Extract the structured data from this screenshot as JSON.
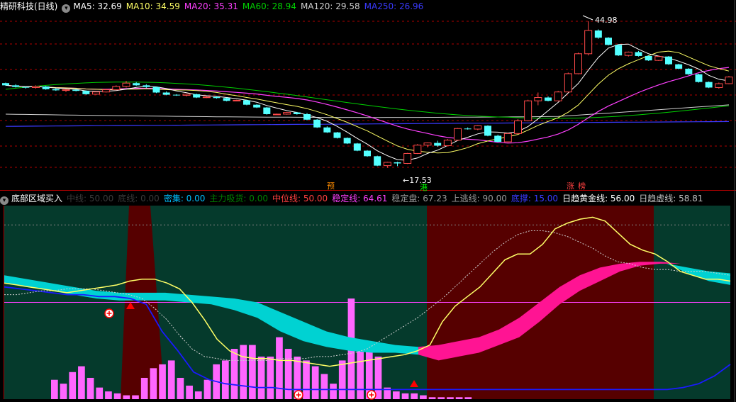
{
  "colors": {
    "bg": "#000000",
    "up": "#ff4a4a",
    "down": "#54ffff",
    "ma5": "#ffffff",
    "ma10": "#ffff66",
    "ma20": "#ff40ff",
    "ma60": "#00d000",
    "ma120": "#d0d0d0",
    "ma250": "#3a3aff",
    "grid": "#b00000",
    "panel_bg": "#053a2c",
    "panel_zone": "#560000",
    "yellow": "#ffff66",
    "cyan": "#00d2d2",
    "pink": "#ff1493",
    "blue": "#1a1aff",
    "bar": "#ff66ff"
  },
  "top_legend": {
    "title": "精研科技(日线)",
    "ma5": "MA5: 32.69",
    "ma10": "MA10: 34.59",
    "ma20": "MA20: 35.31",
    "ma60": "MA60: 28.94",
    "ma120": "MA120: 29.58",
    "ma250": "MA250: 26.96"
  },
  "bottom_legend": {
    "title": "底部区域买入",
    "i1": "中线: 50.00",
    "i2": "底线: 0.00",
    "i3": "密集: 0.00",
    "i4": "主力吸货: 0.00",
    "i5": "中位线: 50.00",
    "i6": "稳定线: 64.61",
    "i7": "稳定盘: 67.23",
    "i8": "上逃线: 90.00",
    "i9": "底撑: 15.00",
    "i10": "日趋黄金线: 56.00",
    "i11": "日趋虚线: 58.81"
  },
  "chart_data": [
    {
      "type": "candlestick",
      "title": "精研科技(日线)",
      "price_range": [
        14.5,
        46.5
      ],
      "annotations": {
        "high_label": "44.98",
        "low_label": "17.53",
        "marker_1": "预",
        "marker_2": "涨",
        "marker_3": "港",
        "marker_4": "榜"
      },
      "candles": [
        [
          33.8,
          33.9,
          33.3,
          33.4
        ],
        [
          33.4,
          33.6,
          33.0,
          33.1
        ],
        [
          33.1,
          33.2,
          32.8,
          33.0
        ],
        [
          33.0,
          33.4,
          32.8,
          33.2
        ],
        [
          33.2,
          33.3,
          32.6,
          32.7
        ],
        [
          32.7,
          32.9,
          32.4,
          32.5
        ],
        [
          32.5,
          32.7,
          32.2,
          32.6
        ],
        [
          32.6,
          32.8,
          32.3,
          32.4
        ],
        [
          32.4,
          32.5,
          31.7,
          31.8
        ],
        [
          31.8,
          32.3,
          31.7,
          32.2
        ],
        [
          32.2,
          32.8,
          32.1,
          32.6
        ],
        [
          32.6,
          33.4,
          32.5,
          33.2
        ],
        [
          33.2,
          34.2,
          33.0,
          33.8
        ],
        [
          33.8,
          34.0,
          33.3,
          33.4
        ],
        [
          33.4,
          33.6,
          32.9,
          33.1
        ],
        [
          33.1,
          33.2,
          32.0,
          32.1
        ],
        [
          32.1,
          32.3,
          31.6,
          31.7
        ],
        [
          31.7,
          31.8,
          31.5,
          31.6
        ],
        [
          31.6,
          31.9,
          31.4,
          31.8
        ],
        [
          31.8,
          31.9,
          31.1,
          31.2
        ],
        [
          31.2,
          31.5,
          31.1,
          31.3
        ],
        [
          31.3,
          31.4,
          31.0,
          31.1
        ],
        [
          31.1,
          31.2,
          30.5,
          30.6
        ],
        [
          30.6,
          30.8,
          30.5,
          30.7
        ],
        [
          30.7,
          30.8,
          29.8,
          29.9
        ],
        [
          29.9,
          30.0,
          29.3,
          29.4
        ],
        [
          29.4,
          29.5,
          28.1,
          28.2
        ],
        [
          28.2,
          28.3,
          28.1,
          28.2
        ],
        [
          28.2,
          28.6,
          28.1,
          28.5
        ],
        [
          28.5,
          28.6,
          28.1,
          28.2
        ],
        [
          28.2,
          28.4,
          27.1,
          27.2
        ],
        [
          27.2,
          27.3,
          25.7,
          25.8
        ],
        [
          25.8,
          26.0,
          24.8,
          24.9
        ],
        [
          24.9,
          25.0,
          23.8,
          23.9
        ],
        [
          23.9,
          24.0,
          22.8,
          22.9
        ],
        [
          22.9,
          23.0,
          21.5,
          21.6
        ],
        [
          21.6,
          21.7,
          20.5,
          20.6
        ],
        [
          20.6,
          20.7,
          18.8,
          18.9
        ],
        [
          18.9,
          19.6,
          18.5,
          19.5
        ],
        [
          19.5,
          19.6,
          18.8,
          19.3
        ],
        [
          19.3,
          21.2,
          19.2,
          21.1
        ],
        [
          21.1,
          22.8,
          21.0,
          22.6
        ],
        [
          22.6,
          23.1,
          22.2,
          23.0
        ],
        [
          23.0,
          23.4,
          22.3,
          22.5
        ],
        [
          22.5,
          23.7,
          22.4,
          23.5
        ],
        [
          23.5,
          25.7,
          23.4,
          25.6
        ],
        [
          25.6,
          25.8,
          25.4,
          25.5
        ],
        [
          25.5,
          26.2,
          25.3,
          26.1
        ],
        [
          26.1,
          26.2,
          24.2,
          24.3
        ],
        [
          24.3,
          24.5,
          23.1,
          23.2
        ],
        [
          23.2,
          24.8,
          23.1,
          24.7
        ],
        [
          24.7,
          27.3,
          24.6,
          27.0
        ],
        [
          27.0,
          30.8,
          26.9,
          30.6
        ],
        [
          30.6,
          32.1,
          29.8,
          31.2
        ],
        [
          31.2,
          31.4,
          30.5,
          30.6
        ],
        [
          30.6,
          32.4,
          30.5,
          32.2
        ],
        [
          32.2,
          35.7,
          32.1,
          35.5
        ],
        [
          35.5,
          39.3,
          35.4,
          39.1
        ],
        [
          39.1,
          44.98,
          38.8,
          43.3
        ],
        [
          43.3,
          43.5,
          41.8,
          42.0
        ],
        [
          42.0,
          42.1,
          40.6,
          40.7
        ],
        [
          40.7,
          40.8,
          38.7,
          38.8
        ],
        [
          38.8,
          39.5,
          38.6,
          39.4
        ],
        [
          39.4,
          39.6,
          38.6,
          38.7
        ],
        [
          38.7,
          38.8,
          37.8,
          37.9
        ],
        [
          37.9,
          38.8,
          37.8,
          38.6
        ],
        [
          38.6,
          38.7,
          37.1,
          37.2
        ],
        [
          37.2,
          37.3,
          36.3,
          36.4
        ],
        [
          36.4,
          36.5,
          35.3,
          35.4
        ],
        [
          35.4,
          35.5,
          33.9,
          34.0
        ],
        [
          34.0,
          34.1,
          32.9,
          33.0
        ],
        [
          33.0,
          33.9,
          32.8,
          33.7
        ],
        [
          33.7,
          35.1,
          33.6,
          34.9
        ]
      ]
    },
    {
      "type": "indicator",
      "title": "底部区域买入",
      "y_range": [
        0,
        100
      ],
      "volume_bars": [
        10,
        8,
        14,
        17,
        11,
        6,
        4,
        3,
        2,
        2,
        11,
        16,
        18,
        20,
        11,
        7,
        4,
        10,
        18,
        20,
        26,
        28,
        28,
        22,
        22,
        32,
        26,
        22,
        20,
        17,
        13,
        8,
        20,
        52,
        30,
        25,
        22,
        6,
        4,
        3,
        3,
        2,
        1,
        1,
        1,
        1,
        1,
        0,
        0,
        0,
        0,
        0,
        0,
        0,
        0,
        0,
        0,
        0,
        0,
        0,
        0,
        0,
        0,
        0,
        0,
        0,
        0,
        0,
        0,
        0,
        0,
        0,
        0,
        0,
        0,
        0
      ],
      "yellow_line": [
        60,
        59,
        58,
        57,
        56,
        55,
        56,
        57,
        58,
        59,
        61,
        62,
        62,
        60,
        57,
        50,
        41,
        31,
        25,
        22,
        21,
        21,
        20,
        20,
        19,
        18,
        17,
        18,
        19,
        20,
        21,
        22,
        23,
        25,
        28,
        40,
        48,
        53,
        58,
        65,
        72,
        75,
        75,
        80,
        88,
        91,
        93,
        94,
        92,
        86,
        80,
        77,
        75,
        71,
        66,
        64,
        62,
        62,
        61
      ],
      "dashed_line": [
        54,
        54,
        55,
        56,
        56,
        57,
        57,
        57,
        56,
        55,
        54,
        52,
        47,
        41,
        33,
        26,
        22,
        21,
        20,
        20,
        20,
        20,
        21,
        21,
        21,
        22,
        22,
        23,
        24,
        26,
        30,
        34,
        38,
        42,
        47,
        52,
        58,
        64,
        70,
        76,
        81,
        85,
        87,
        87,
        86,
        84,
        81,
        78,
        74,
        71,
        70,
        68,
        67,
        67,
        66,
        66,
        66,
        65,
        64
      ],
      "cyan_band": [
        [
          64,
          60
        ],
        [
          62,
          58
        ],
        [
          60,
          56
        ],
        [
          58,
          54
        ],
        [
          56,
          52
        ],
        [
          55,
          51
        ],
        [
          55,
          51
        ],
        [
          55,
          51
        ],
        [
          54,
          50
        ],
        [
          53,
          49
        ],
        [
          52,
          46
        ],
        [
          50,
          42
        ],
        [
          45,
          35
        ],
        [
          40,
          30
        ],
        [
          35,
          27
        ],
        [
          32,
          25
        ],
        [
          30,
          24
        ],
        [
          28,
          24
        ],
        [
          27,
          23
        ]
      ],
      "pink_band": [
        [
          27,
          23
        ],
        [
          28,
          20
        ],
        [
          30,
          22
        ],
        [
          32,
          24
        ],
        [
          36,
          28
        ],
        [
          42,
          32
        ],
        [
          50,
          40
        ],
        [
          58,
          49
        ],
        [
          64,
          56
        ],
        [
          68,
          61
        ],
        [
          70,
          66
        ],
        [
          71,
          69
        ],
        [
          71,
          70
        ],
        [
          70,
          70
        ]
      ],
      "blue_line": [
        58,
        57,
        56,
        55,
        54,
        54,
        53,
        53,
        52,
        49,
        35,
        25,
        14,
        10,
        8,
        7,
        6,
        6,
        5,
        5,
        5,
        5,
        5,
        5,
        5,
        5,
        5,
        5,
        5,
        5,
        5,
        5,
        5,
        5,
        5,
        5,
        5,
        5,
        5,
        5,
        5,
        5,
        5,
        6,
        8,
        12,
        18
      ]
    }
  ]
}
